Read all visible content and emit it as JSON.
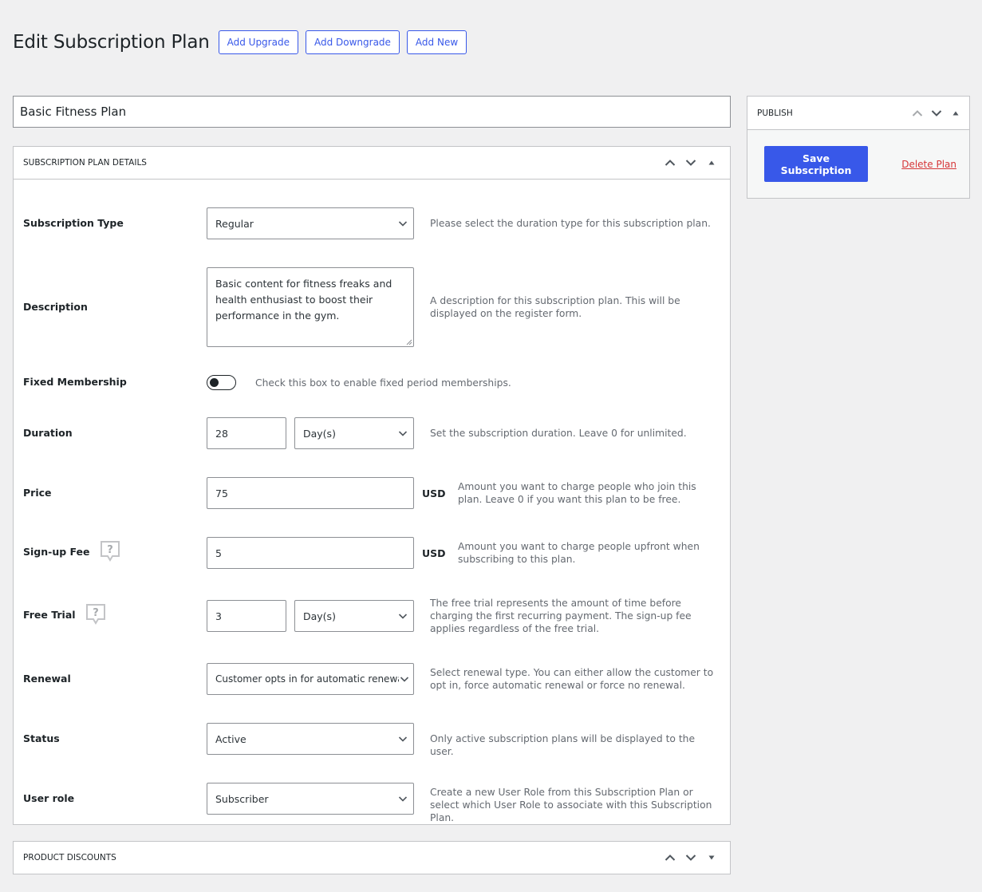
{
  "header": {
    "title": "Edit Subscription Plan",
    "buttons": {
      "add_upgrade": "Add Upgrade",
      "add_downgrade": "Add Downgrade",
      "add_new": "Add New"
    }
  },
  "plan_name": "Basic Fitness Plan",
  "details": {
    "title": "Subscription Plan Details",
    "fields": {
      "subscription_type": {
        "label": "Subscription Type",
        "value": "Regular",
        "description": "Please select the duration type for this subscription plan."
      },
      "description": {
        "label": "Description",
        "value": "Basic content for fitness freaks and health enthusiast to boost their performance in the gym.",
        "description": "A description for this subscription plan. This will be displayed on the register form."
      },
      "fixed_membership": {
        "label": "Fixed Membership",
        "enabled": false,
        "description": "Check this box to enable fixed period memberships."
      },
      "duration": {
        "label": "Duration",
        "value": "28",
        "unit": "Day(s)",
        "description": "Set the subscription duration. Leave 0 for unlimited."
      },
      "price": {
        "label": "Price",
        "value": "75",
        "currency": "USD",
        "description": "Amount you want to charge people who join this plan. Leave 0 if you want this plan to be free."
      },
      "signup_fee": {
        "label": "Sign-up Fee",
        "value": "5",
        "currency": "USD",
        "description": "Amount you want to charge people upfront when subscribing to this plan."
      },
      "free_trial": {
        "label": "Free Trial",
        "value": "3",
        "unit": "Day(s)",
        "description": "The free trial represents the amount of time before charging the first recurring payment. The sign-up fee applies regardless of the free trial."
      },
      "renewal": {
        "label": "Renewal",
        "value": "Customer opts in for automatic renewal",
        "description": "Select renewal type. You can either allow the customer to opt in, force automatic renewal or force no renewal."
      },
      "status": {
        "label": "Status",
        "value": "Active",
        "description": "Only active subscription plans will be displayed to the user."
      },
      "user_role": {
        "label": "User role",
        "value": "Subscriber",
        "description": "Create a new User Role from this Subscription Plan or select which User Role to associate with this Subscription Plan."
      }
    }
  },
  "discounts": {
    "title": "Product Discounts"
  },
  "publish": {
    "title": "Publish",
    "save_label": "Save Subscription",
    "delete_label": "Delete Plan"
  },
  "colors": {
    "accent": "#3858e9",
    "danger": "#d63638",
    "background": "#f0f0f1"
  },
  "icons": {
    "move_up": "chevron-up-icon",
    "move_down": "chevron-down-icon",
    "toggle_panel": "triangle-icon",
    "help": "help-bubble-icon",
    "select_arrow": "chevron-down-icon"
  }
}
